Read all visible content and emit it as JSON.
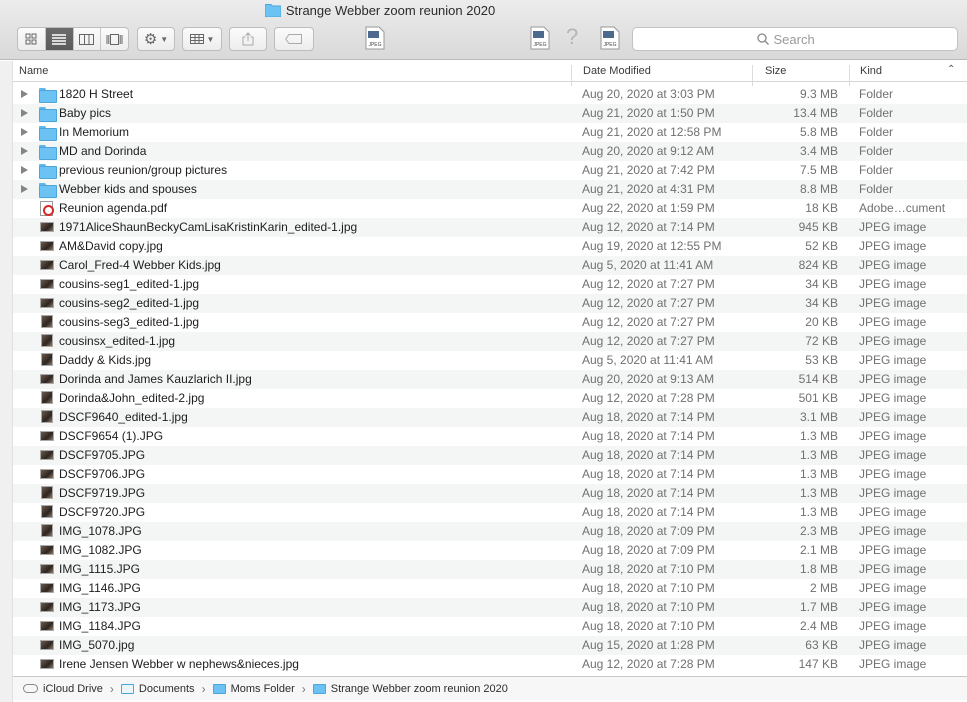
{
  "window": {
    "title": "Strange Webber zoom reunion 2020"
  },
  "toolbar": {
    "view_modes": [
      "icon-view",
      "list-view",
      "column-view",
      "gallery-view"
    ],
    "active_view": "list-view",
    "search_placeholder": "Search"
  },
  "columns": {
    "name": "Name",
    "date": "Date Modified",
    "size": "Size",
    "kind": "Kind"
  },
  "rows": [
    {
      "name": "1820 H Street",
      "date": "Aug 20, 2020 at 3:03 PM",
      "size": "9.3 MB",
      "kind": "Folder",
      "type": "folder"
    },
    {
      "name": "Baby pics",
      "date": "Aug 21, 2020 at 1:50 PM",
      "size": "13.4 MB",
      "kind": "Folder",
      "type": "folder"
    },
    {
      "name": "In Memorium",
      "date": "Aug 21, 2020 at 12:58 PM",
      "size": "5.8 MB",
      "kind": "Folder",
      "type": "folder"
    },
    {
      "name": "MD and Dorinda",
      "date": "Aug 20, 2020 at 9:12 AM",
      "size": "3.4 MB",
      "kind": "Folder",
      "type": "folder"
    },
    {
      "name": "previous reunion/group pictures",
      "date": "Aug 21, 2020 at 7:42 PM",
      "size": "7.5 MB",
      "kind": "Folder",
      "type": "folder"
    },
    {
      "name": "Webber kids and spouses",
      "date": "Aug 21, 2020 at 4:31 PM",
      "size": "8.8 MB",
      "kind": "Folder",
      "type": "folder"
    },
    {
      "name": "Reunion agenda.pdf",
      "date": "Aug 22, 2020 at 1:59 PM",
      "size": "18 KB",
      "kind": "Adobe…cument",
      "type": "pdf"
    },
    {
      "name": "1971AliceShaunBeckyCamLisaKristinKarin_edited-1.jpg",
      "date": "Aug 12, 2020 at 7:14 PM",
      "size": "945 KB",
      "kind": "JPEG image",
      "type": "land"
    },
    {
      "name": "AM&David copy.jpg",
      "date": "Aug 19, 2020 at 12:55 PM",
      "size": "52 KB",
      "kind": "JPEG image",
      "type": "land"
    },
    {
      "name": "Carol_Fred-4 Webber Kids.jpg",
      "date": "Aug 5, 2020 at 11:41 AM",
      "size": "824 KB",
      "kind": "JPEG image",
      "type": "land"
    },
    {
      "name": "cousins-seg1_edited-1.jpg",
      "date": "Aug 12, 2020 at 7:27 PM",
      "size": "34 KB",
      "kind": "JPEG image",
      "type": "land"
    },
    {
      "name": "cousins-seg2_edited-1.jpg",
      "date": "Aug 12, 2020 at 7:27 PM",
      "size": "34 KB",
      "kind": "JPEG image",
      "type": "land"
    },
    {
      "name": "cousins-seg3_edited-1.jpg",
      "date": "Aug 12, 2020 at 7:27 PM",
      "size": "20 KB",
      "kind": "JPEG image",
      "type": "port"
    },
    {
      "name": "cousinsx_edited-1.jpg",
      "date": "Aug 12, 2020 at 7:27 PM",
      "size": "72 KB",
      "kind": "JPEG image",
      "type": "port"
    },
    {
      "name": "Daddy & Kids.jpg",
      "date": "Aug 5, 2020 at 11:41 AM",
      "size": "53 KB",
      "kind": "JPEG image",
      "type": "port"
    },
    {
      "name": "Dorinda and James Kauzlarich II.jpg",
      "date": "Aug 20, 2020 at 9:13 AM",
      "size": "514 KB",
      "kind": "JPEG image",
      "type": "land"
    },
    {
      "name": "Dorinda&John_edited-2.jpg",
      "date": "Aug 12, 2020 at 7:28 PM",
      "size": "501 KB",
      "kind": "JPEG image",
      "type": "port"
    },
    {
      "name": "DSCF9640_edited-1.jpg",
      "date": "Aug 18, 2020 at 7:14 PM",
      "size": "3.1 MB",
      "kind": "JPEG image",
      "type": "port"
    },
    {
      "name": "DSCF9654 (1).JPG",
      "date": "Aug 18, 2020 at 7:14 PM",
      "size": "1.3 MB",
      "kind": "JPEG image",
      "type": "land"
    },
    {
      "name": "DSCF9705.JPG",
      "date": "Aug 18, 2020 at 7:14 PM",
      "size": "1.3 MB",
      "kind": "JPEG image",
      "type": "land"
    },
    {
      "name": "DSCF9706.JPG",
      "date": "Aug 18, 2020 at 7:14 PM",
      "size": "1.3 MB",
      "kind": "JPEG image",
      "type": "land"
    },
    {
      "name": "DSCF9719.JPG",
      "date": "Aug 18, 2020 at 7:14 PM",
      "size": "1.3 MB",
      "kind": "JPEG image",
      "type": "port"
    },
    {
      "name": "DSCF9720.JPG",
      "date": "Aug 18, 2020 at 7:14 PM",
      "size": "1.3 MB",
      "kind": "JPEG image",
      "type": "port"
    },
    {
      "name": "IMG_1078.JPG",
      "date": "Aug 18, 2020 at 7:09 PM",
      "size": "2.3 MB",
      "kind": "JPEG image",
      "type": "port"
    },
    {
      "name": "IMG_1082.JPG",
      "date": "Aug 18, 2020 at 7:09 PM",
      "size": "2.1 MB",
      "kind": "JPEG image",
      "type": "land"
    },
    {
      "name": "IMG_1115.JPG",
      "date": "Aug 18, 2020 at 7:10 PM",
      "size": "1.8 MB",
      "kind": "JPEG image",
      "type": "land"
    },
    {
      "name": "IMG_1146.JPG",
      "date": "Aug 18, 2020 at 7:10 PM",
      "size": "2 MB",
      "kind": "JPEG image",
      "type": "land"
    },
    {
      "name": "IMG_1173.JPG",
      "date": "Aug 18, 2020 at 7:10 PM",
      "size": "1.7 MB",
      "kind": "JPEG image",
      "type": "land"
    },
    {
      "name": "IMG_1184.JPG",
      "date": "Aug 18, 2020 at 7:10 PM",
      "size": "2.4 MB",
      "kind": "JPEG image",
      "type": "land"
    },
    {
      "name": "IMG_5070.jpg",
      "date": "Aug 15, 2020 at 1:28 PM",
      "size": "63 KB",
      "kind": "JPEG image",
      "type": "land"
    },
    {
      "name": "Irene Jensen Webber w nephews&nieces.jpg",
      "date": "Aug 12, 2020 at 7:28 PM",
      "size": "147 KB",
      "kind": "JPEG image",
      "type": "land"
    }
  ],
  "pathbar": [
    {
      "label": "iCloud Drive",
      "icon": "cloud-icon"
    },
    {
      "label": "Documents",
      "icon": "documents-folder-icon"
    },
    {
      "label": "Moms Folder",
      "icon": "folder-icon"
    },
    {
      "label": "Strange Webber zoom reunion 2020",
      "icon": "folder-icon"
    }
  ]
}
